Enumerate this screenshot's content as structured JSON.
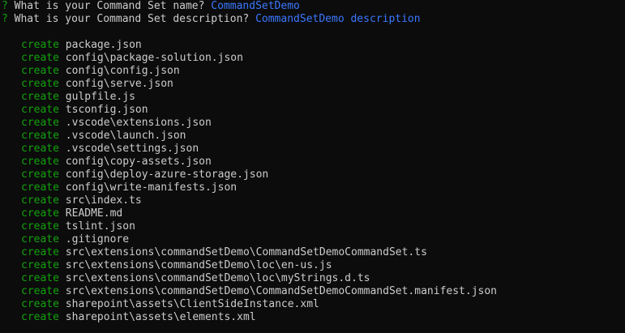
{
  "prompts": [
    {
      "mark": "?",
      "question": " What is your Command Set name? ",
      "answer": "CommandSetDemo"
    },
    {
      "mark": "?",
      "question": " What is your Command Set description? ",
      "answer": "CommandSetDemo description"
    }
  ],
  "create_label": "create",
  "files": [
    "package.json",
    "config\\package-solution.json",
    "config\\config.json",
    "config\\serve.json",
    "gulpfile.js",
    "tsconfig.json",
    ".vscode\\extensions.json",
    ".vscode\\launch.json",
    ".vscode\\settings.json",
    "config\\copy-assets.json",
    "config\\deploy-azure-storage.json",
    "config\\write-manifests.json",
    "src\\index.ts",
    "README.md",
    "tslint.json",
    ".gitignore",
    "src\\extensions\\commandSetDemo\\CommandSetDemoCommandSet.ts",
    "src\\extensions\\commandSetDemo\\loc\\en-us.js",
    "src\\extensions\\commandSetDemo\\loc\\myStrings.d.ts",
    "src\\extensions\\commandSetDemo\\CommandSetDemoCommandSet.manifest.json",
    "sharepoint\\assets\\ClientSideInstance.xml",
    "sharepoint\\assets\\elements.xml"
  ],
  "colors": {
    "background": "#0c0c0c",
    "text": "#cccccc",
    "green": "#13a10e",
    "blue": "#3b78ff"
  }
}
